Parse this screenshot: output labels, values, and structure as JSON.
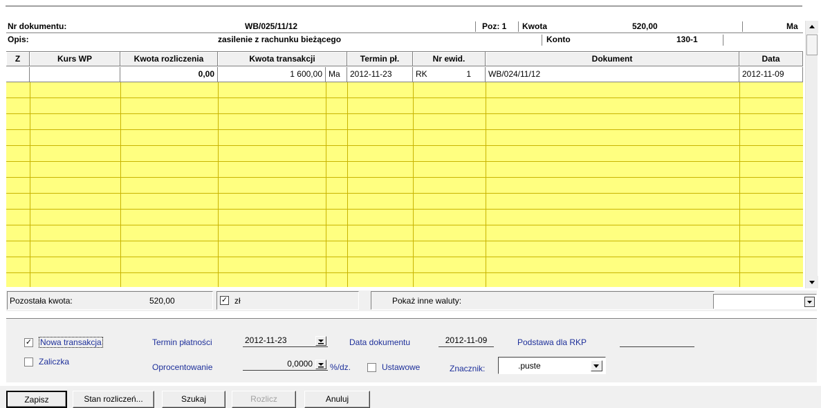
{
  "header": {
    "nr_dokumentu_label": "Nr dokumentu:",
    "nr_dokumentu_value": "WB/025/11/12",
    "poz_label": "Poz: 1",
    "kwota_label": "Kwota",
    "kwota_value": "520,00",
    "strona": "Ma",
    "opis_label": "Opis:",
    "opis_value": "zasilenie z rachunku bieżącego",
    "konto_label": "Konto",
    "konto_value": "130-1"
  },
  "columns": [
    "Z",
    "Kurs WP",
    "Kwota rozliczenia",
    "Kwota transakcji",
    "Termin pł.",
    "Nr ewid.",
    "Dokument",
    "Data"
  ],
  "rows": [
    {
      "z": "",
      "kurs_wp": "",
      "kwota_rozliczenia": "0,00",
      "kwota_transakcji": "1 600,00",
      "strona": "Ma",
      "termin": "2012-11-23",
      "nr_ewid_prefix": "RK",
      "nr_ewid_num": "1",
      "dokument": "WB/024/11/12",
      "data": "2012-11-09"
    }
  ],
  "summary": {
    "pozostala_label": "Pozostała kwota:",
    "pozostala_value": "520,00",
    "zl_checked": true,
    "zl_label": "zł",
    "pokaz_label": "Pokaż inne waluty:",
    "waluta_value": ""
  },
  "options": {
    "nowa_transakcja_label": "Nowa transakcja",
    "nowa_transakcja_checked": true,
    "zaliczka_label": "Zaliczka",
    "zaliczka_checked": false,
    "termin_platnosci_label": "Termin płatności",
    "termin_platnosci_value": "2012-11-23",
    "data_dokumentu_label": "Data dokumentu",
    "data_dokumentu_value": "2012-11-09",
    "podstawa_label": "Podstawa dla RKP",
    "podstawa_value": "",
    "oprocentowanie_label": "Oprocentowanie",
    "oprocentowanie_value": "0,0000",
    "oprocentowanie_unit": "%/dz.",
    "ustawowe_label": "Ustawowe",
    "ustawowe_checked": false,
    "znacznik_label": "Znacznik:",
    "znacznik_value": ".puste"
  },
  "buttons": {
    "zapisz": "Zapisz",
    "stan_rozliczen": "Stan rozliczeń...",
    "szukaj": "Szukaj",
    "rozlicz": "Rozlicz",
    "anuluj": "Anuluj"
  },
  "colors": {
    "grid_fill": "#ffff80",
    "label_blue": "#1d2f9a"
  }
}
